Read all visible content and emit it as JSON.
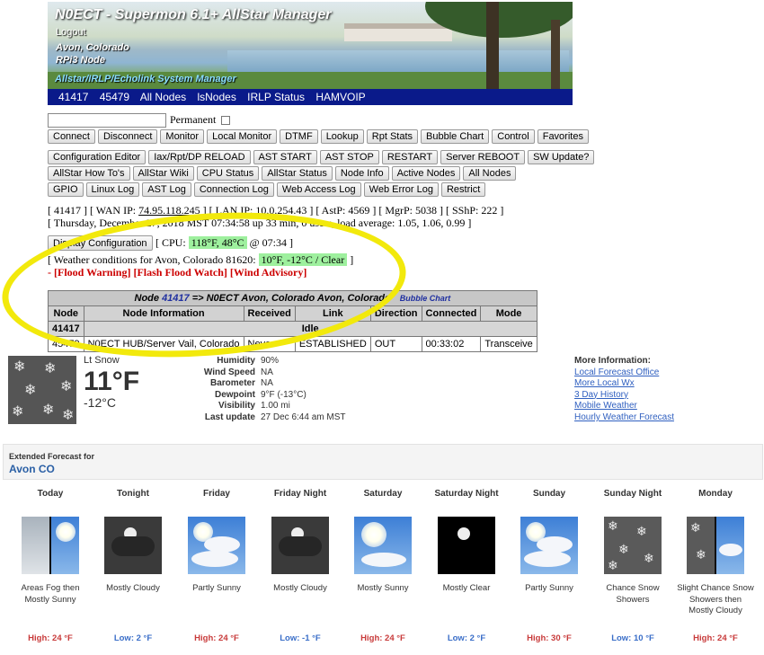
{
  "header": {
    "title": "N0ECT - Supermon 6.1+ AllStar Manager",
    "logout": "Logout",
    "location": "Avon, Colorado",
    "node_type": "RPi3 Node",
    "system": "Allstar/IRLP/Echolink System Manager"
  },
  "nav": [
    "41417",
    "45479",
    "All Nodes",
    "lsNodes",
    "IRLP Status",
    "HAMVOIP"
  ],
  "permanent_label": "Permanent",
  "buttons_row1": [
    "Connect",
    "Disconnect",
    "Monitor",
    "Local Monitor",
    "DTMF",
    "Lookup",
    "Rpt Stats",
    "Bubble Chart",
    "Control",
    "Favorites"
  ],
  "buttons_row2": [
    "Configuration Editor",
    "Iax/Rpt/DP RELOAD",
    "AST START",
    "AST STOP",
    "RESTART",
    "Server REBOOT",
    "SW Update?"
  ],
  "buttons_row3": [
    "AllStar How To's",
    "AllStar Wiki",
    "CPU Status",
    "AllStar Status",
    "Node Info",
    "Active Nodes",
    "All Nodes"
  ],
  "buttons_row4": [
    "GPIO",
    "Linux Log",
    "AST Log",
    "Connection Log",
    "Web Access Log",
    "Web Error Log",
    "Restrict"
  ],
  "status": {
    "node": "[ 41417 ] [ WAN IP: ",
    "wan_ip": "74.95.118.245",
    "rest": " ] [ LAN IP: 10.0.254.43 ] [ AstP: 4569 ] [ MgrP: 5038 ] [ SShP: 222 ]",
    "uptime": "[ Thursday, December 27, 2018 MST 07:34:58 up 33 min,  0 users,  load average: 1.05, 1.06, 0.99 ]"
  },
  "display_config_button": "Display Configuration",
  "cpu": {
    "label": "[ CPU: ",
    "value": "118°F, 48°C",
    "time": " @ 07:34 ]"
  },
  "weather_line": {
    "label": "[ Weather conditions for Avon, Colorado 81620: ",
    "value": "10°F, -12°C / Clear",
    "end": " ]"
  },
  "alerts": "- [Flood Warning] [Flash Flood Watch] [Wind Advisory]",
  "node_table": {
    "header_prefix": "Node ",
    "node_link": "41417",
    "header_suffix": " => N0ECT Avon, Colorado Avon, Colorado",
    "bubble": "Bubble Chart",
    "columns": [
      "Node",
      "Node Information",
      "Received",
      "Link",
      "Direction",
      "Connected",
      "Mode"
    ],
    "idle_row": {
      "node": "41417",
      "status": "Idle"
    },
    "rows": [
      {
        "node": "45479",
        "info": "N0ECT HUB/Server Vail, Colorado",
        "received": "Never",
        "link": "ESTABLISHED",
        "direction": "OUT",
        "connected": "00:33:02",
        "mode": "Transceive"
      }
    ]
  },
  "current_wx": {
    "condition": "Lt Snow",
    "temp_f": "11°F",
    "temp_c": "-12°C",
    "details": [
      {
        "k": "Humidity",
        "v": "90%"
      },
      {
        "k": "Wind Speed",
        "v": "NA"
      },
      {
        "k": "Barometer",
        "v": "NA"
      },
      {
        "k": "Dewpoint",
        "v": "9°F (-13°C)"
      },
      {
        "k": "Visibility",
        "v": "1.00 mi"
      },
      {
        "k": "Last update",
        "v": "27 Dec 6:44 am MST"
      }
    ],
    "more_info_title": "More Information:",
    "more_info_links": [
      "Local Forecast Office",
      "More Local Wx",
      "3 Day History",
      "Mobile Weather",
      "Hourly Weather Forecast"
    ]
  },
  "extended": {
    "label": "Extended Forecast for",
    "location": "Avon CO",
    "days": [
      {
        "name": "Today",
        "icon": "fog-sun-icon",
        "desc": "Areas Fog then Mostly Sunny",
        "temp": "High: 24 °F",
        "kind": "hi"
      },
      {
        "name": "Tonight",
        "icon": "mostly-cloudy-night-icon",
        "desc": "Mostly Cloudy",
        "temp": "Low: 2 °F",
        "kind": "lo"
      },
      {
        "name": "Friday",
        "icon": "partly-sunny-icon",
        "desc": "Partly Sunny",
        "temp": "High: 24 °F",
        "kind": "hi"
      },
      {
        "name": "Friday Night",
        "icon": "mostly-cloudy-night-icon",
        "desc": "Mostly Cloudy",
        "temp": "Low: -1 °F",
        "kind": "lo"
      },
      {
        "name": "Saturday",
        "icon": "mostly-sunny-icon",
        "desc": "Mostly Sunny",
        "temp": "High: 24 °F",
        "kind": "hi"
      },
      {
        "name": "Saturday Night",
        "icon": "clear-night-icon",
        "desc": "Mostly Clear",
        "temp": "Low: 2 °F",
        "kind": "lo"
      },
      {
        "name": "Sunday",
        "icon": "partly-sunny-icon",
        "desc": "Partly Sunny",
        "temp": "High: 30 °F",
        "kind": "hi"
      },
      {
        "name": "Sunday Night",
        "icon": "snow-icon",
        "desc": "Chance Snow Showers",
        "temp": "Low: 10 °F",
        "kind": "lo"
      },
      {
        "name": "Monday",
        "icon": "snow-sun-icon",
        "desc": "Slight Chance Snow Showers then Mostly Cloudy",
        "temp": "High: 24 °F",
        "kind": "hi"
      }
    ]
  }
}
